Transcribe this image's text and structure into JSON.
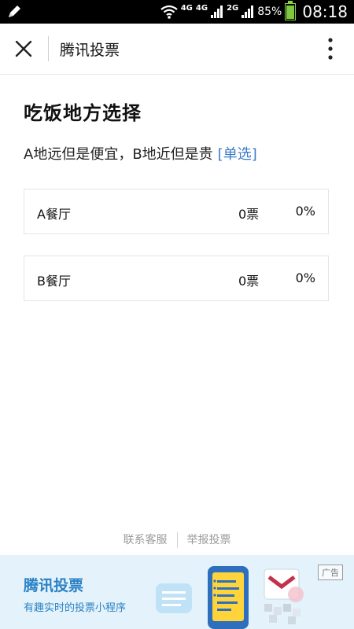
{
  "status": {
    "network1": "4G",
    "network2": "4G",
    "network3": "2G",
    "battery": "85%",
    "time": "08:18"
  },
  "header": {
    "title": "腾讯投票"
  },
  "poll": {
    "title": "吃饭地方选择",
    "description": "A地远但是便宜，B地近但是贵",
    "type_tag": "[单选]",
    "options": [
      {
        "label": "A餐厅",
        "votes": "0票",
        "percent": "0%"
      },
      {
        "label": "B餐厅",
        "votes": "0票",
        "percent": "0%"
      }
    ]
  },
  "footer": {
    "contact": "联系客服",
    "report": "举报投票"
  },
  "ad": {
    "title": "腾讯投票",
    "subtitle": "有趣实时的投票小程序",
    "badge": "广告"
  },
  "colors": {
    "accent_link": "#3a7bc8",
    "ad_background": "#e4f2fb",
    "ad_text": "#2a82c4"
  }
}
